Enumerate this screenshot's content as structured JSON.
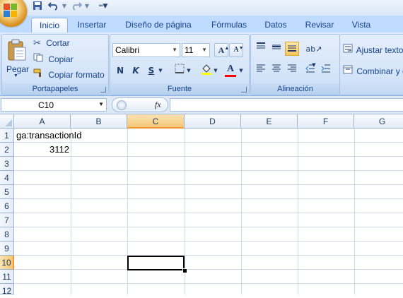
{
  "quick_access": {
    "save_icon": "save-icon",
    "undo_icon": "undo-icon",
    "redo_icon": "redo-icon",
    "customize_icon": "customize-qat-icon"
  },
  "tabs": [
    {
      "label": "Inicio",
      "active": true
    },
    {
      "label": "Insertar"
    },
    {
      "label": "Diseño de página"
    },
    {
      "label": "Fórmulas"
    },
    {
      "label": "Datos"
    },
    {
      "label": "Revisar"
    },
    {
      "label": "Vista"
    }
  ],
  "clipboard": {
    "paste_label": "Pegar",
    "cut_label": "Cortar",
    "copy_label": "Copiar",
    "format_painter_label": "Copiar formato",
    "group_label": "Portapapeles"
  },
  "font": {
    "family_value": "Calibri",
    "size_value": "11",
    "bold": "N",
    "italic": "K",
    "underline": "S",
    "font_color_letter": "A",
    "grow_letter": "A",
    "shrink_letter": "A",
    "group_label": "Fuente",
    "highlight_color": "#ffff00",
    "font_color": "#ff0000"
  },
  "alignment": {
    "wrap_text_label": "Ajustar texto",
    "merge_label": "Combinar y c",
    "group_label": "Alineación"
  },
  "formula_bar": {
    "name_box": "C10",
    "fx_label": "fx",
    "formula": ""
  },
  "columns": [
    "A",
    "B",
    "C",
    "D",
    "E",
    "F",
    "G"
  ],
  "rows": [
    "1",
    "2",
    "3",
    "4",
    "5",
    "6",
    "7",
    "8",
    "9",
    "10",
    "11",
    "12"
  ],
  "cells": {
    "A1": "ga:transactionId",
    "A2": "3112"
  },
  "selection": {
    "cell": "C10",
    "column": "C",
    "row": "10"
  },
  "colors": {
    "ribbon": "#c7dcf6",
    "tab_bar": "#bfdbff",
    "selection_header": "#f5c778",
    "gridline": "#d0d7e5"
  }
}
